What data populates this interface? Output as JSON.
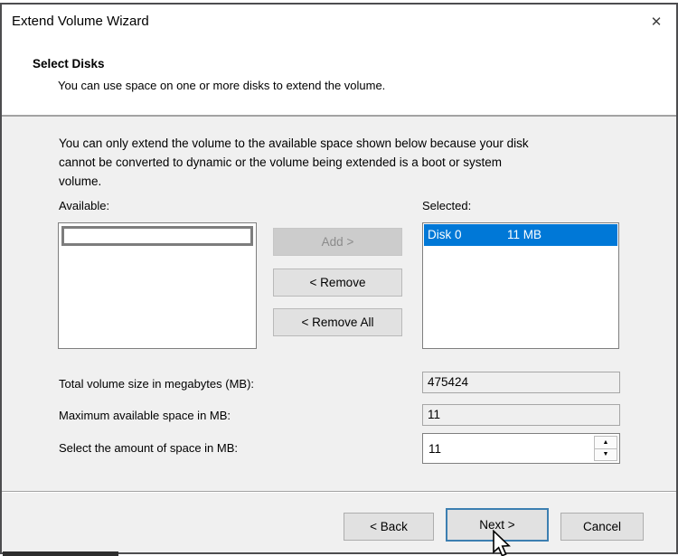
{
  "window": {
    "title": "Extend Volume Wizard"
  },
  "icons": {
    "close": "✕",
    "spin_up": "▲",
    "spin_down": "▼"
  },
  "header": {
    "heading": "Select Disks",
    "subheading": "You can use space on one or more disks to extend the volume."
  },
  "body": {
    "description_lines": [
      "You can only extend the volume to the available space shown below because your disk",
      "cannot be converted to dynamic or the volume being extended is a boot or system",
      "volume."
    ],
    "available_label": "Available:",
    "selected_label": "Selected:",
    "add_button": "Add >",
    "remove_button": "< Remove",
    "remove_all_button": "< Remove All",
    "selected_items": [
      {
        "disk": "Disk 0",
        "size": "11 MB"
      }
    ],
    "fields": [
      {
        "label": "Total volume size in megabytes (MB):",
        "value": "475424"
      },
      {
        "label": "Maximum available space in MB:",
        "value": "11"
      },
      {
        "label": "Select the amount of space in MB:",
        "value": "11"
      }
    ]
  },
  "footer": {
    "back_button": "< Back",
    "next_button": "Next >",
    "cancel_button": "Cancel"
  },
  "colors": {
    "selection_blue": "#0078d7",
    "focus_border_blue": "#3c7fb1",
    "dialog_gray": "#f0f0f0",
    "button_face": "#e1e1e1"
  }
}
